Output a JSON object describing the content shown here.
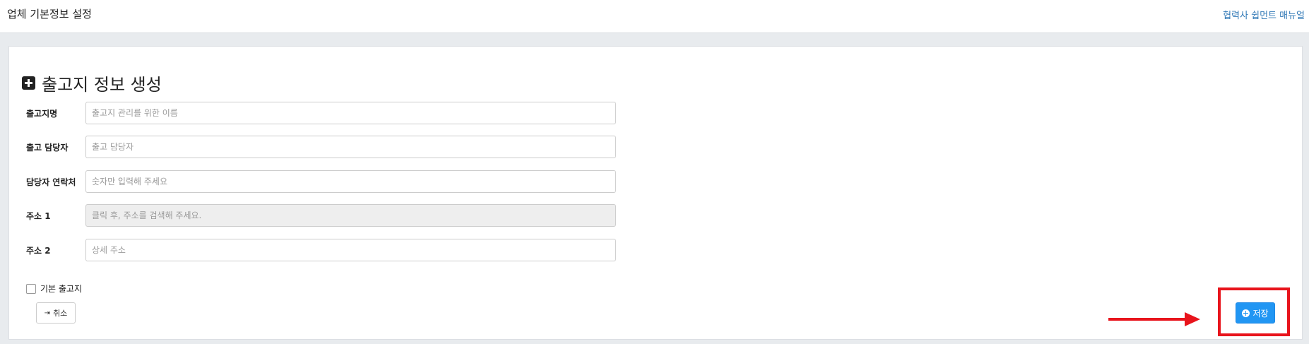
{
  "header": {
    "title": "업체 기본정보 설정",
    "manual_link": "협력사 쉽먼트 매뉴얼"
  },
  "form": {
    "section_title": "출고지 정보 생성",
    "section_icon": "plus-square-icon",
    "fields": [
      {
        "label": "출고지명",
        "placeholder": "출고지 관리를 위한 이름",
        "value": ""
      },
      {
        "label": "출고 담당자",
        "placeholder": "출고 담당자",
        "value": ""
      },
      {
        "label": "담당자 연락처",
        "placeholder": "숫자만 입력해 주세요",
        "value": ""
      },
      {
        "label": "주소 1",
        "placeholder": "클릭 후, 주소를 검색해 주세요.",
        "value": ""
      },
      {
        "label": "주소 2",
        "placeholder": "상세 주소",
        "value": ""
      }
    ],
    "checkbox_label": "기본 출고지",
    "checkbox_checked": false,
    "cancel_label": "취소",
    "cancel_icon": "sign-out-icon",
    "save_label": "저장",
    "save_icon": "plus-circle-icon"
  },
  "annotation": {
    "arrow_color": "#e8141c",
    "highlight_color": "#e8141c"
  },
  "colors": {
    "primary": "#2196f3",
    "link": "#337ab7",
    "background": "#e8ebee"
  }
}
